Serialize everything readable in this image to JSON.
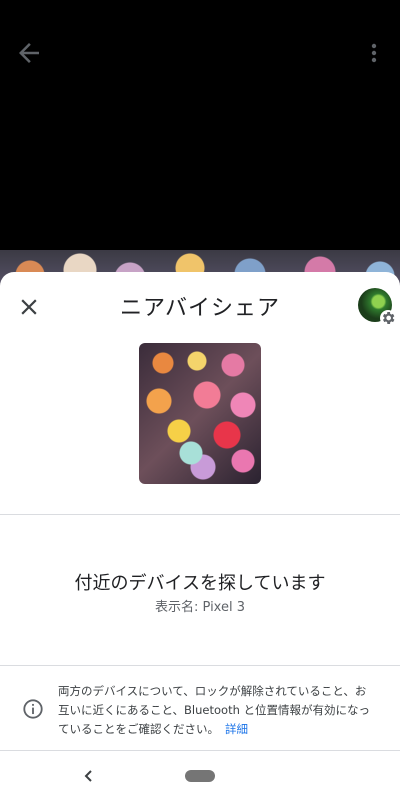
{
  "sheet": {
    "title": "ニアバイシェア",
    "status_title": "付近のデバイスを探しています",
    "device_name_line": "表示名: Pixel 3"
  },
  "info": {
    "message": "両方のデバイスについて、ロックが解除されていること、お互いに近くにあること、Bluetooth と位置情報が有効になっていることをご確認ください。",
    "link_label": "詳細"
  },
  "icons": {
    "back": "arrow-back-icon",
    "more": "more-vert-icon",
    "close": "close-icon",
    "info": "info-icon",
    "settings": "gear-icon"
  },
  "colors": {
    "link": "#1a73e8",
    "text_primary": "#202124",
    "text_secondary": "#5f6368"
  }
}
